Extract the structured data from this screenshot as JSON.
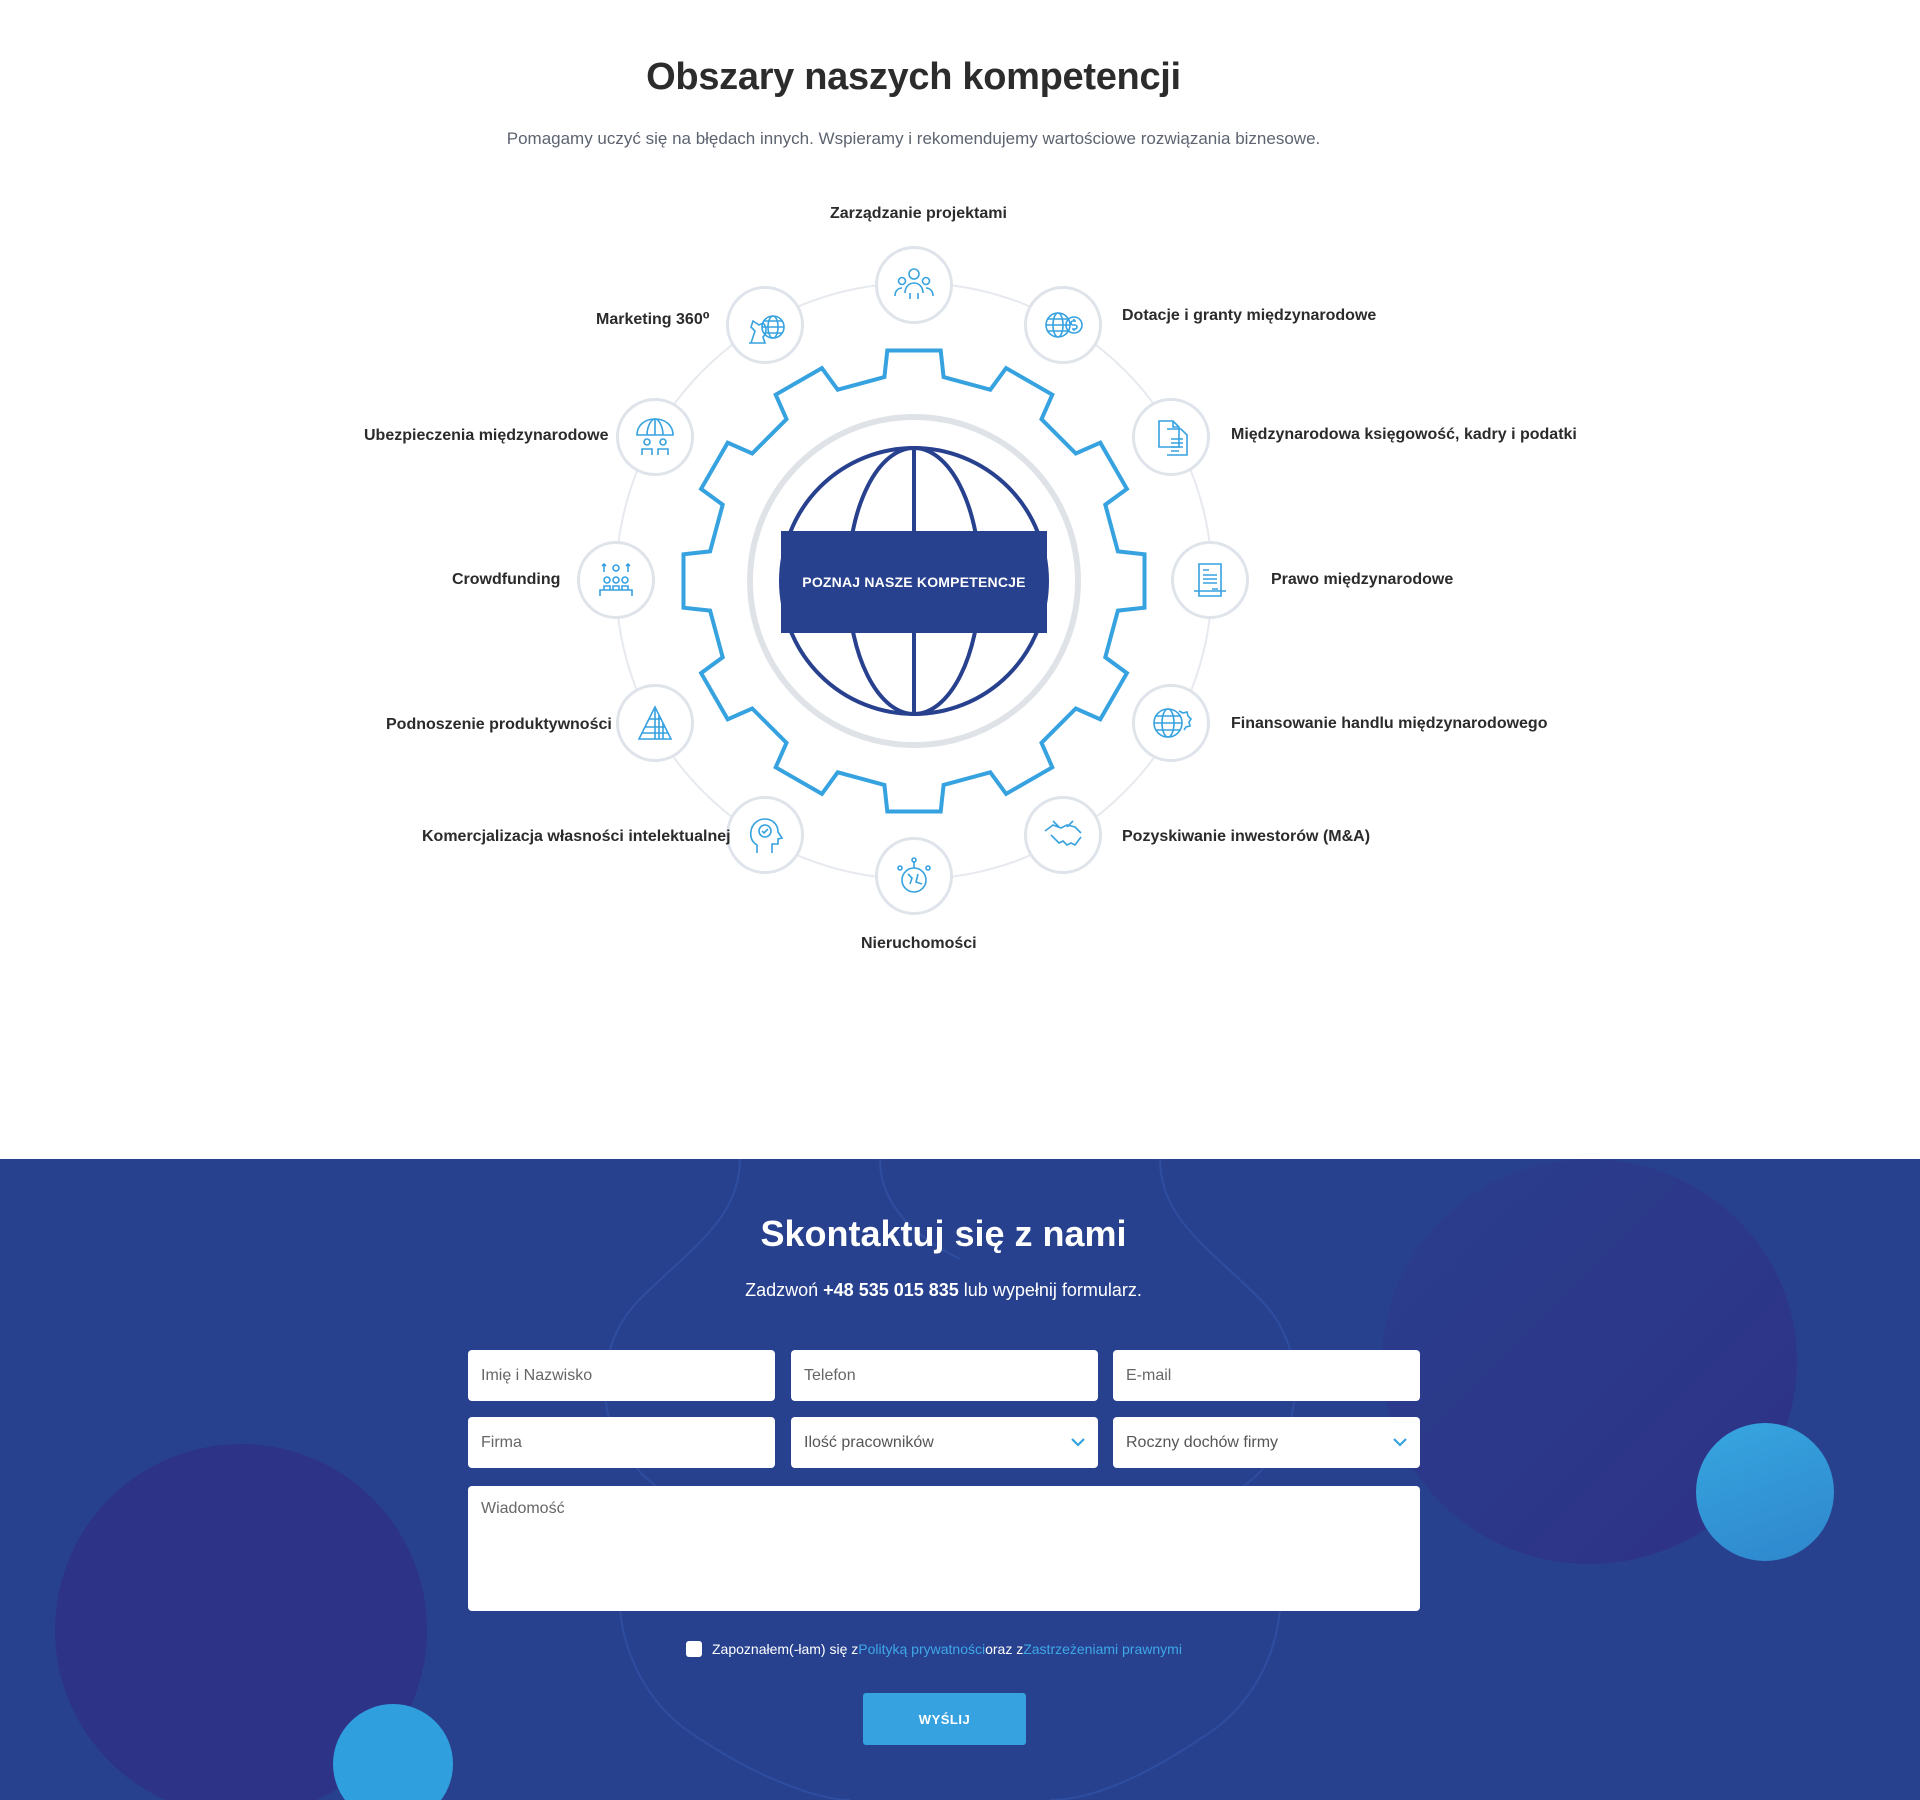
{
  "competences": {
    "title": "Obszary naszych kompetencji",
    "subtitle": "Pomagamy uczyć się na błędach innych. Wspieramy i rekomendujemy wartościowe rozwiązania biznesowe.",
    "center_button": "POZNAJ NASZE KOMPETENCJE",
    "items": [
      {
        "label": "Zarządzanie projektami",
        "icon": "people-icon"
      },
      {
        "label": "Dotacje i granty międzynarodowe",
        "icon": "globe-coin-icon"
      },
      {
        "label": "Międzynarodowa księgowość, kadry i podatki",
        "icon": "documents-icon"
      },
      {
        "label": "Prawo międzynarodowe",
        "icon": "contract-icon"
      },
      {
        "label": "Finansowanie handlu międzynarodowego",
        "icon": "globe-gear-icon"
      },
      {
        "label": "Pozyskiwanie inwestorów (M&A)",
        "icon": "handshake-icon"
      },
      {
        "label": "Nieruchomości",
        "icon": "location-network-icon"
      },
      {
        "label": "Komercjalizacja własności intelektualnej",
        "icon": "head-idea-icon"
      },
      {
        "label": "Podnoszenie produktywności",
        "icon": "pyramid-icon"
      },
      {
        "label": "Crowdfunding",
        "icon": "crowd-icon"
      },
      {
        "label": "Ubezpieczenia międzynarodowe",
        "icon": "umbrella-people-icon"
      },
      {
        "label": "Marketing 360⁰",
        "icon": "chess-globe-icon"
      }
    ]
  },
  "contact": {
    "title": "Skontaktuj się z nami",
    "call_prefix": "Zadzwoń ",
    "phone": "+48 535 015 835",
    "call_suffix": " lub wypełnij formularz.",
    "fields": {
      "name": "Imię i Nazwisko",
      "phone": "Telefon",
      "email": "E-mail",
      "company": "Firma",
      "employees": "Ilość pracowników",
      "income": "Roczny dochów firmy",
      "message": "Wiadomość"
    },
    "consent": {
      "prefix": "Zapoznałem(-łam) się z ",
      "privacy_link": "Polityką prywatności",
      "middle": " oraz z ",
      "legal_link": "Zastrzeżeniami prawnymi"
    },
    "submit": "WYŚLIJ"
  },
  "colors": {
    "navy": "#28418f",
    "accent": "#36a2df",
    "ring": "#dfe4ea"
  }
}
